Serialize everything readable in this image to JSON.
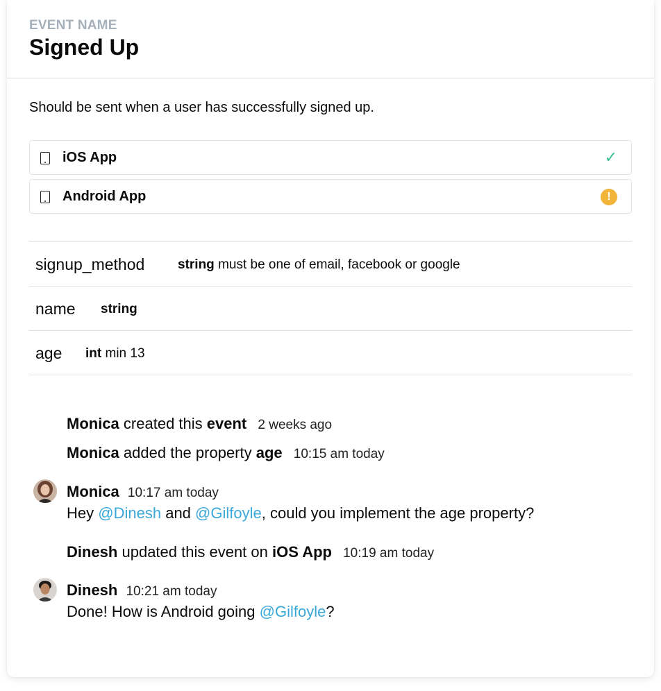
{
  "event": {
    "eyebrow": "EVENT NAME",
    "name": "Signed Up",
    "description": "Should be sent when a user has successfully signed up."
  },
  "sources": [
    {
      "name": "iOS App",
      "status": "ok",
      "status_icon": "check-icon",
      "status_color": "#3cbf8f"
    },
    {
      "name": "Android App",
      "status": "warning",
      "status_icon": "warning-icon",
      "status_color": "#f2b53c"
    }
  ],
  "properties": [
    {
      "name": "signup_method",
      "type": "string",
      "rule": "must be one of email, facebook or google"
    },
    {
      "name": "name",
      "type": "string",
      "rule": ""
    },
    {
      "name": "age",
      "type": "int",
      "rule": "min 13"
    }
  ],
  "activity": {
    "a1": {
      "user": "Monica",
      "text": "created this",
      "object": "event",
      "time": "2 weeks ago"
    },
    "a2": {
      "user": "Monica",
      "text": "added the property",
      "object": "age",
      "time": "10:15 am today"
    },
    "c1": {
      "user": "Monica",
      "time": "10:17 am today",
      "pre": "Hey",
      "m1": "@Dinesh",
      "mid": "and",
      "m2": "@Gilfoyle",
      "post": ", could you implement the age property?"
    },
    "a3": {
      "user": "Dinesh",
      "text": "updated this event on",
      "object": "iOS App",
      "time": "10:19 am today"
    },
    "c2": {
      "user": "Dinesh",
      "time": "10:21 am today",
      "pre": "Done! How is Android going",
      "m1": "@Gilfoyle",
      "post": "?"
    }
  },
  "colors": {
    "accent_mention": "#3aa8d8",
    "eyebrow": "#a6b0ba"
  }
}
